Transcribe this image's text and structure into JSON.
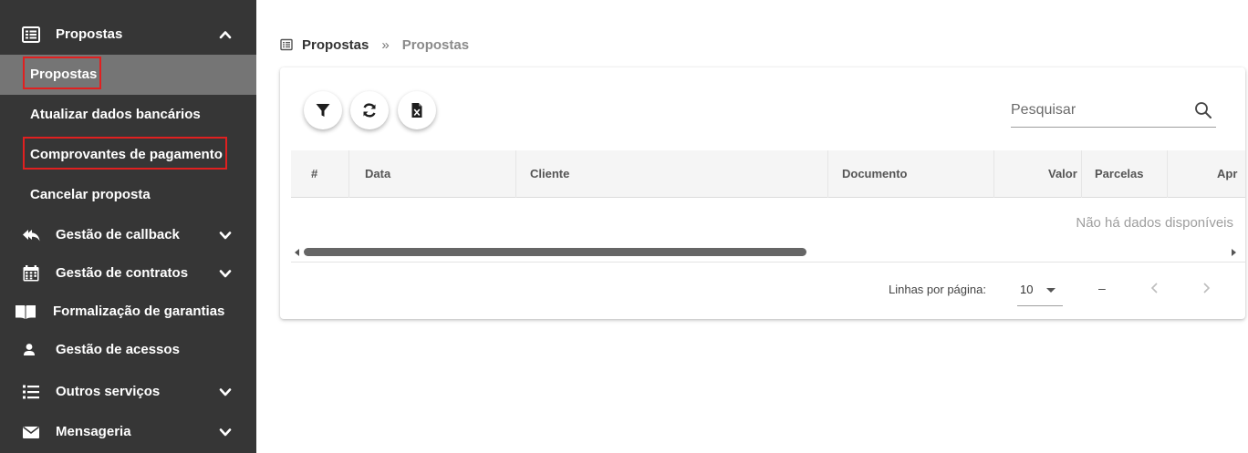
{
  "sidebar": {
    "section_propostas": {
      "label": "Propostas",
      "icon": "list-box-icon",
      "expanded": true
    },
    "sub_items": [
      {
        "label": "Propostas",
        "active": true,
        "highlighted": true
      },
      {
        "label": "Atualizar dados bancários",
        "active": false,
        "highlighted": false
      },
      {
        "label": "Comprovantes de pagamento",
        "active": false,
        "highlighted": true
      },
      {
        "label": "Cancelar proposta",
        "active": false,
        "highlighted": false
      }
    ],
    "items": [
      {
        "label": "Gestão de callback",
        "icon": "reply-all-icon",
        "has_chevron": true
      },
      {
        "label": "Gestão de contratos",
        "icon": "calendar-icon",
        "has_chevron": true
      },
      {
        "label": "Formalização de garantias",
        "icon": "book-open-icon",
        "has_chevron": false
      },
      {
        "label": "Gestão de acessos",
        "icon": "user-icon",
        "has_chevron": false
      },
      {
        "label": "Outros serviços",
        "icon": "list-icon",
        "has_chevron": true
      },
      {
        "label": "Mensageria",
        "icon": "envelope-icon",
        "has_chevron": true
      }
    ]
  },
  "breadcrumb": {
    "icon": "list-box-icon",
    "first": "Propostas",
    "separator": "»",
    "second": "Propostas"
  },
  "toolbar": {
    "buttons": [
      "filter-icon",
      "refresh-icon",
      "excel-file-icon"
    ]
  },
  "search": {
    "placeholder": "Pesquisar",
    "value": "",
    "icon": "search-icon"
  },
  "table": {
    "columns": [
      "#",
      "Data",
      "Cliente",
      "Documento",
      "Valor",
      "Parcelas",
      "Apr"
    ],
    "rows": [],
    "empty_message": "Não há dados disponíveis"
  },
  "pagination": {
    "rows_per_page_label": "Linhas por página:",
    "rows_per_page_value": "10",
    "range_text": "–"
  },
  "colors": {
    "sidebar_bg": "#363636",
    "sidebar_active_bg": "#757575",
    "highlight_border": "#e02020"
  }
}
